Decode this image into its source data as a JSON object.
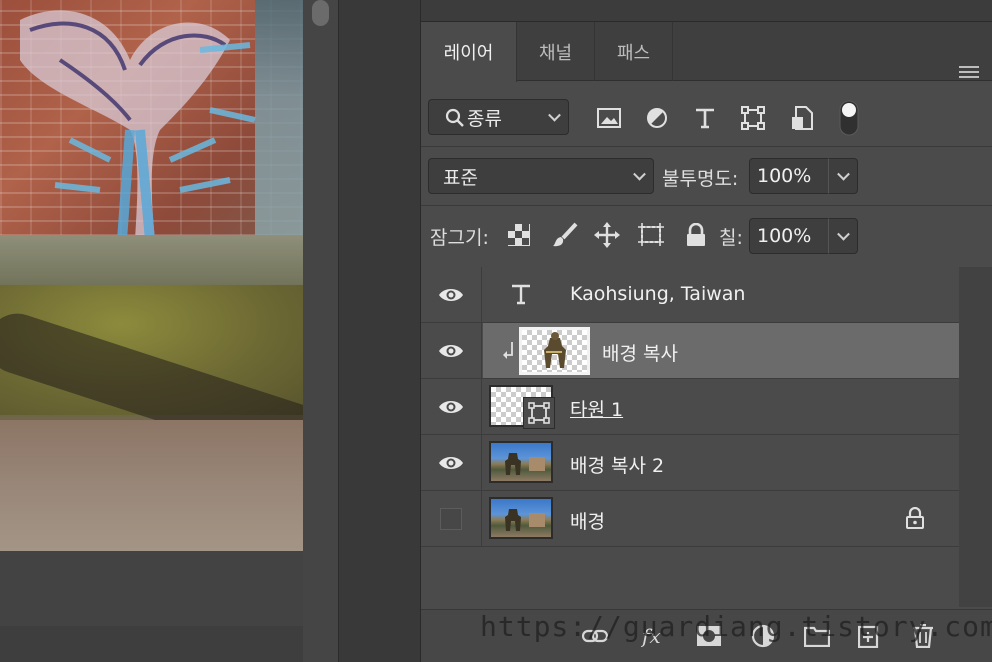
{
  "tabs": [
    {
      "label": "레이어",
      "active": true
    },
    {
      "label": "채널",
      "active": false
    },
    {
      "label": "패스",
      "active": false
    }
  ],
  "filter": {
    "kind_label": "종류",
    "icons": [
      "image-filter-icon",
      "adjustment-filter-icon",
      "type-filter-icon",
      "shape-filter-icon",
      "smart-object-filter-icon",
      "filter-toggle-icon"
    ]
  },
  "blend": {
    "mode": "표준",
    "opacity_label": "불투명도:",
    "opacity_value": "100%"
  },
  "lock": {
    "label": "잠그기:",
    "fill_label": "칠:",
    "fill_value": "100%"
  },
  "layers": [
    {
      "name": "Kaohsiung, Taiwan",
      "kind": "text",
      "visible": true,
      "selected": false
    },
    {
      "name": "배경 복사",
      "kind": "clipped-pixel",
      "visible": true,
      "selected": true
    },
    {
      "name": "타원 1",
      "kind": "shape",
      "visible": true,
      "selected": false
    },
    {
      "name": "배경 복사 2",
      "kind": "pixel",
      "visible": true,
      "selected": false
    },
    {
      "name": "배경",
      "kind": "background",
      "visible": false,
      "selected": false,
      "locked": true
    }
  ],
  "watermark": "https://guardiang.tistory.com/",
  "colors": {
    "panel_bg": "#4b4b4b",
    "selected_row": "#6b6b6b",
    "tab_bg": "#3f3f3f"
  }
}
